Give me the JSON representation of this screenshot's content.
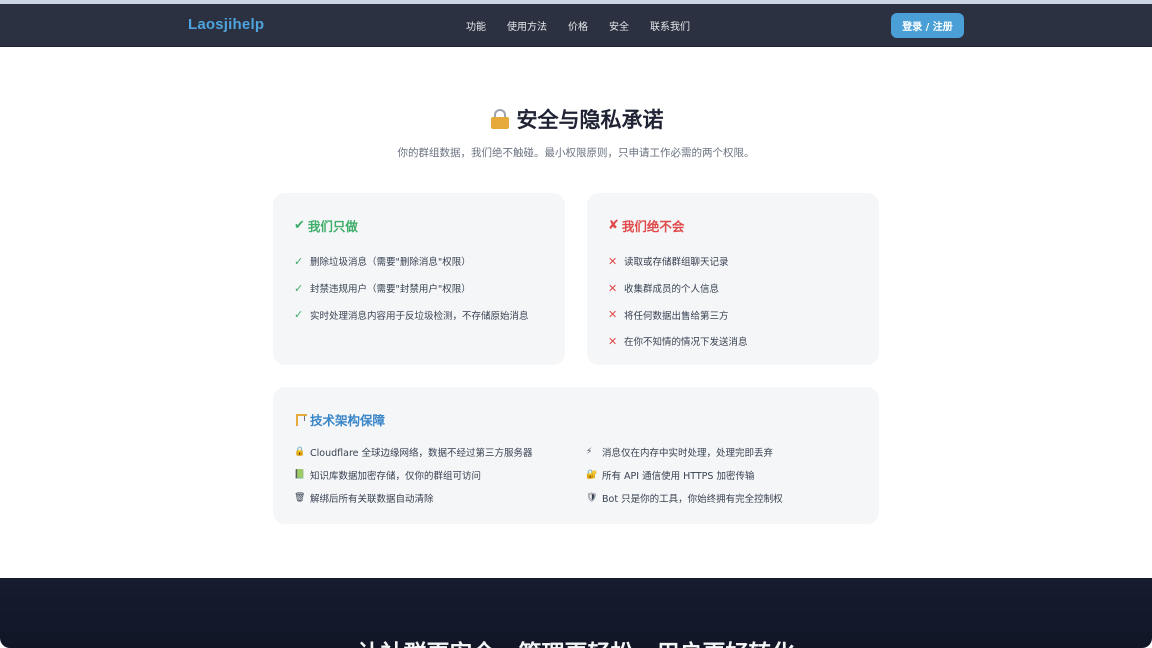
{
  "nav": {
    "brand": "Laosjihelp",
    "links": [
      "功能",
      "使用方法",
      "价格",
      "安全",
      "联系我们"
    ],
    "login": "登录 / 注册"
  },
  "header": {
    "title": "安全与隐私承诺",
    "subtitle": "你的群组数据，我们绝不触碰。最小权限原则，只申请工作必需的两个权限。"
  },
  "do_card": {
    "mark": "✔",
    "title": "我们只做",
    "items": [
      "删除垃圾消息（需要\"删除消息\"权限）",
      "封禁违规用户（需要\"封禁用户\"权限）",
      "实时处理消息内容用于反垃圾检测，不存储原始消息"
    ]
  },
  "dont_card": {
    "mark": "✘",
    "title": "我们绝不会",
    "items": [
      "读取或存储群组聊天记录",
      "收集群成员的个人信息",
      "将任何数据出售给第三方",
      "在你不知情的情况下发送消息"
    ]
  },
  "tech_card": {
    "title": "技术架构保障",
    "items": [
      {
        "icon": "lock-icon",
        "glyph": "🔒",
        "text": "Cloudflare 全球边缘网络，数据不经过第三方服务器"
      },
      {
        "icon": "lightning-icon",
        "glyph": "⚡",
        "text": "消息仅在内存中实时处理，处理完即丢弃"
      },
      {
        "icon": "book-icon",
        "glyph": "📗",
        "text": "知识库数据加密存储，仅你的群组可访问"
      },
      {
        "icon": "lock-key-icon",
        "glyph": "🔐",
        "text": "所有 API 通信使用 HTTPS 加密传输"
      },
      {
        "icon": "trash-icon",
        "glyph": "🗑",
        "text": "解绑后所有关联数据自动清除"
      },
      {
        "icon": "shield-icon",
        "glyph": "🛡",
        "text": "Bot 只是你的工具，你始终拥有完全控制权"
      }
    ]
  },
  "footer": {
    "text": "让社群更安全，管理更轻松，用户更好转化"
  },
  "colors": {
    "navbar": "#2b3140",
    "brand": "#4fa3de",
    "button": "#4a9fd6",
    "green": "#3fae6a",
    "red": "#e04a4a",
    "blue": "#3a86c8"
  }
}
